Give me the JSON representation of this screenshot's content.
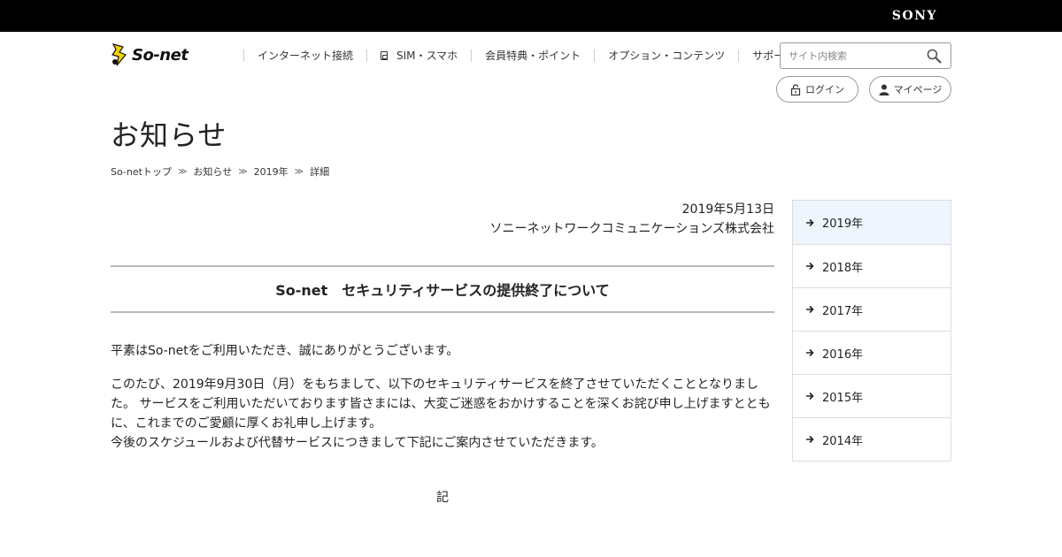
{
  "brand": {
    "sony": "SONY",
    "logo_text": "So-net"
  },
  "nav": {
    "items": [
      {
        "label": "インターネット接続",
        "icon": ""
      },
      {
        "label": "SIM・スマホ",
        "icon": "sim-icon"
      },
      {
        "label": "会員特典・ポイント",
        "icon": ""
      },
      {
        "label": "オプション・コンテンツ",
        "icon": ""
      },
      {
        "label": "サポート",
        "icon": ""
      }
    ]
  },
  "search": {
    "placeholder": "サイト内検索"
  },
  "account": {
    "login_label": "ログイン",
    "mypage_label": "マイページ"
  },
  "page": {
    "title": "お知らせ"
  },
  "breadcrumb": {
    "items": [
      "So-netトップ",
      "お知らせ",
      "2019年",
      "詳細"
    ],
    "separator": "≫"
  },
  "article": {
    "date": "2019年5月13日",
    "company": "ソニーネットワークコミュニケーションズ株式会社",
    "title": "So-net　セキュリティサービスの提供終了について",
    "paragraphs": [
      "平素はSo-netをご利用いただき、誠にありがとうございます。",
      "このたび、2019年9月30日（月）をもちまして、以下のセキュリティサービスを終了させていただくこととなりました。 サービスをご利用いただいております皆さまには、大変ご迷惑をおかけすることを深くお詫び申し上げますとともに、これまでのご愛顧に厚くお礼申し上げます。",
      "今後のスケジュールおよび代替サービスにつきまして下記にご案内させていただきます。"
    ],
    "ki": "記"
  },
  "sidebar": {
    "years": [
      "2019年",
      "2018年",
      "2017年",
      "2016年",
      "2015年",
      "2014年"
    ],
    "active_index": 0
  },
  "colors": {
    "sidebar_active_bg": "#eef5fd",
    "logo_yellow": "#f2d200",
    "top_bar": "#000000"
  }
}
